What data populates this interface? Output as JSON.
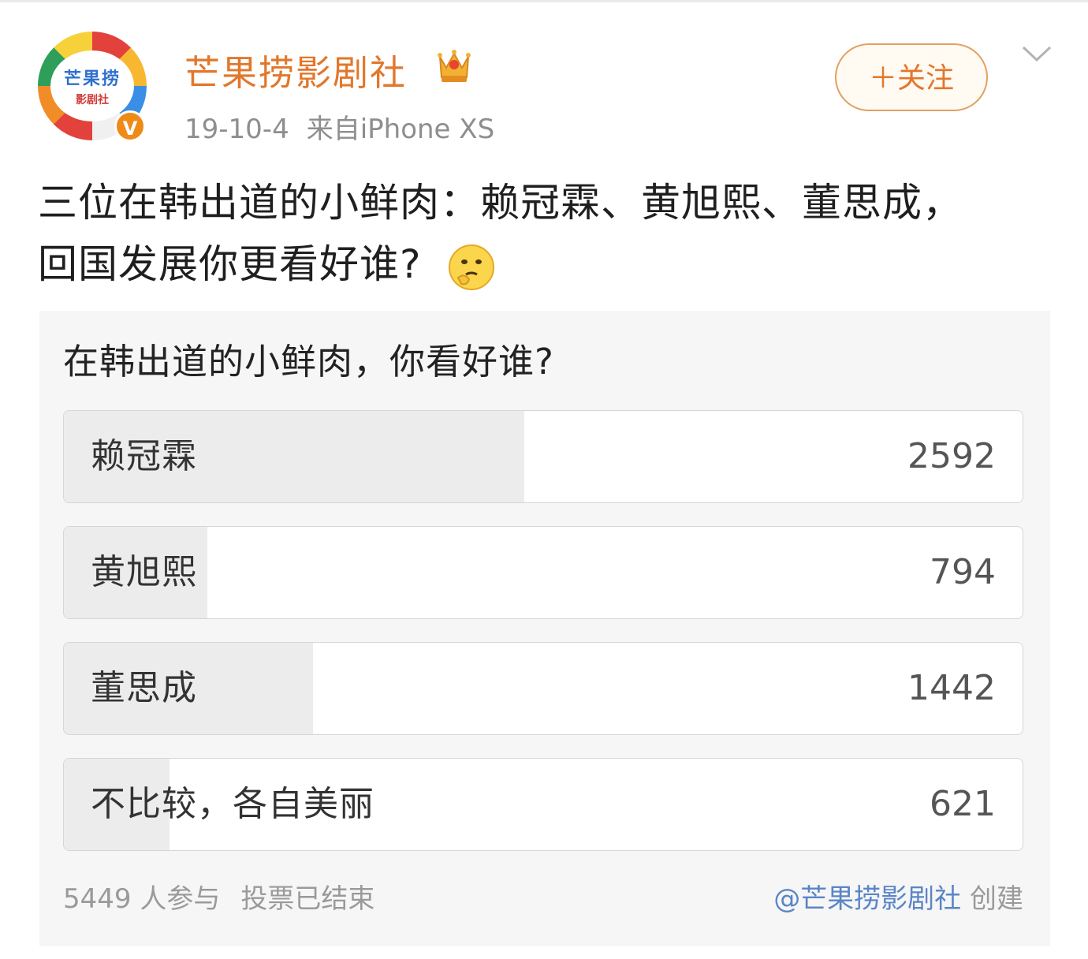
{
  "avatar": {
    "line1": "芒果捞",
    "line2": "影剧社",
    "verified_badge": "V"
  },
  "user": {
    "name": "芒果捞影剧社",
    "date": "19-10-4",
    "source": "来自iPhone XS",
    "follow_label": "＋关注"
  },
  "post": {
    "line1": "三位在韩出道的小鲜肉：赖冠霖、黄旭熙、董思成，",
    "line2": "回国发展你更看好谁?"
  },
  "poll": {
    "title": "在韩出道的小鲜肉，你看好谁?",
    "options": [
      {
        "label": "赖冠霖",
        "count": "2592",
        "share": 0.48
      },
      {
        "label": "黄旭熙",
        "count": "794",
        "share": 0.15
      },
      {
        "label": "董思成",
        "count": "1442",
        "share": 0.26
      },
      {
        "label": "不比较，各自美丽",
        "count": "621",
        "share": 0.11
      }
    ],
    "participants": "5449 人参与",
    "status": "投票已结束",
    "creator": "@芒果捞影剧社",
    "created_label": "创建"
  },
  "icons": {
    "crown": "crown-icon",
    "verified": "verified-v-icon",
    "emoji": "thinking-emoji-icon",
    "menu": "chevron-down-icon"
  },
  "colors": {
    "username": "#e2772b",
    "creator_link": "#5a85c7",
    "bar_fill": "#ececec",
    "verified": "#f08a17"
  }
}
